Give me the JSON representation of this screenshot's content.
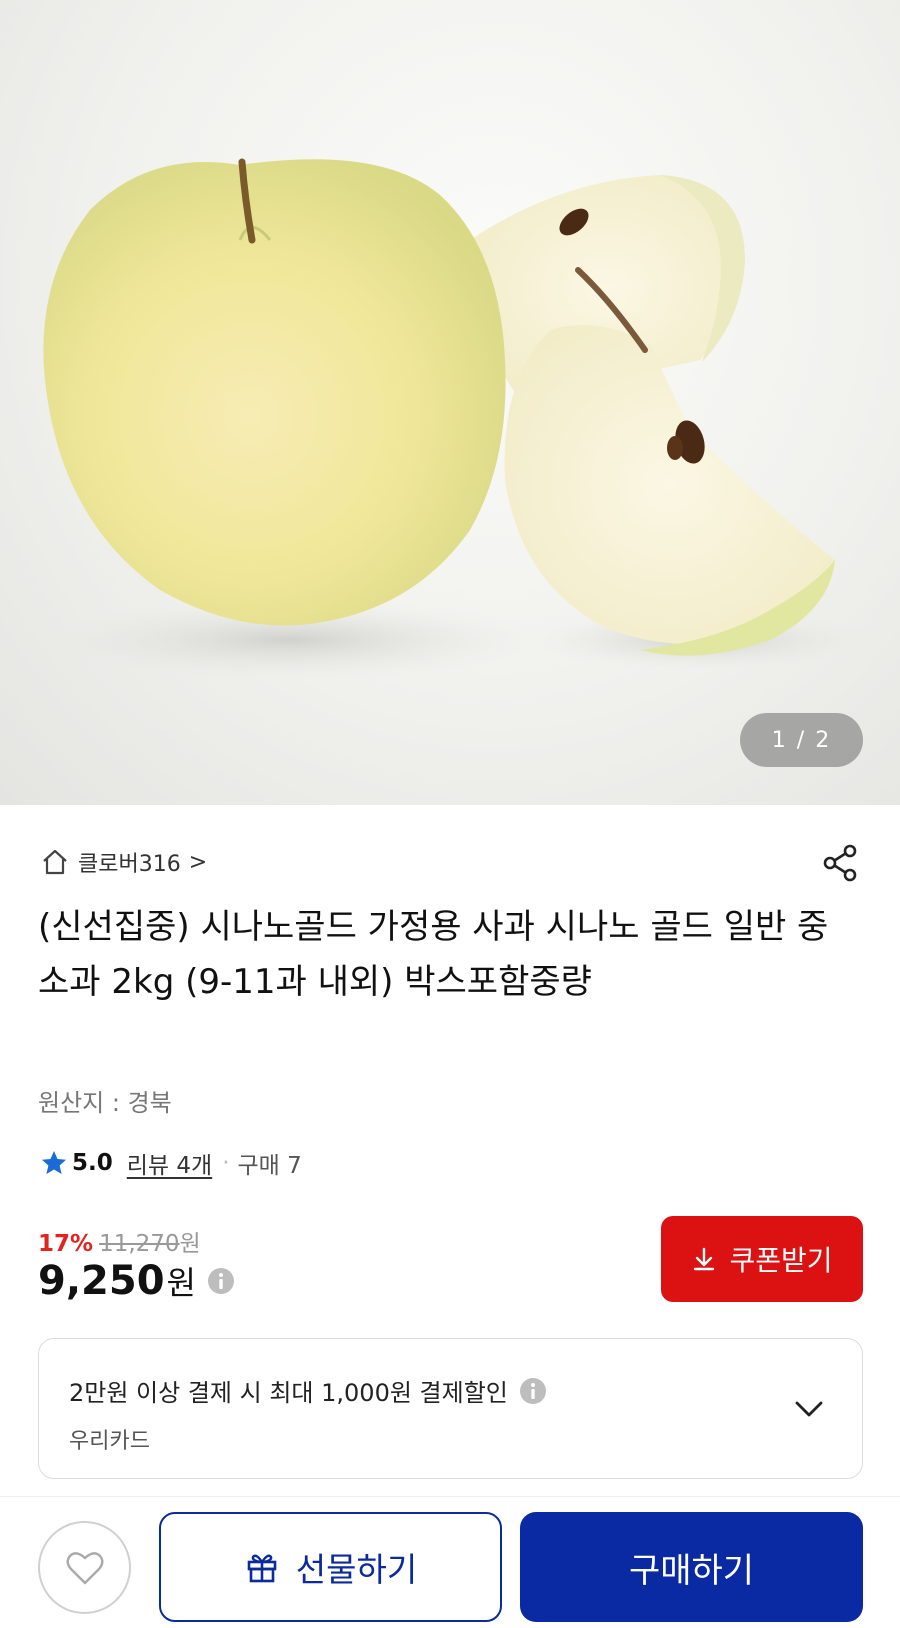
{
  "gallery": {
    "pager_text": "1 / 2"
  },
  "store": {
    "name": "클로버316",
    "chevron": ">"
  },
  "product": {
    "title": "(신선집중) 시나노골드 가정용 사과 시나노 골드 일반 중소과 2kg (9-11과 내외) 박스포함중량",
    "origin": "원산지 : 경북",
    "rating": "5.0",
    "review_link": "리뷰 4개",
    "separator": "·",
    "purchases": "구매 7"
  },
  "pricing": {
    "discount": "17%",
    "original_price": "11,270",
    "original_unit": "원",
    "price": "9,250",
    "price_unit": "원",
    "coupon_label": "쿠폰받기"
  },
  "card_promo": {
    "text": "2만원 이상 결제 시 최대 1,000원 결제할인",
    "card_name": "우리카드"
  },
  "bottom_bar": {
    "gift_label": "선물하기",
    "buy_label": "구매하기"
  },
  "colors": {
    "discount_red": "#e0241f",
    "coupon_red": "#dc1212",
    "primary_blue": "#0a2aa3",
    "star_blue": "#1a6bd6"
  },
  "icons": [
    "home-icon",
    "share-icon",
    "star-icon",
    "info-icon",
    "download-icon",
    "chevron-down-icon",
    "heart-icon",
    "gift-icon"
  ]
}
